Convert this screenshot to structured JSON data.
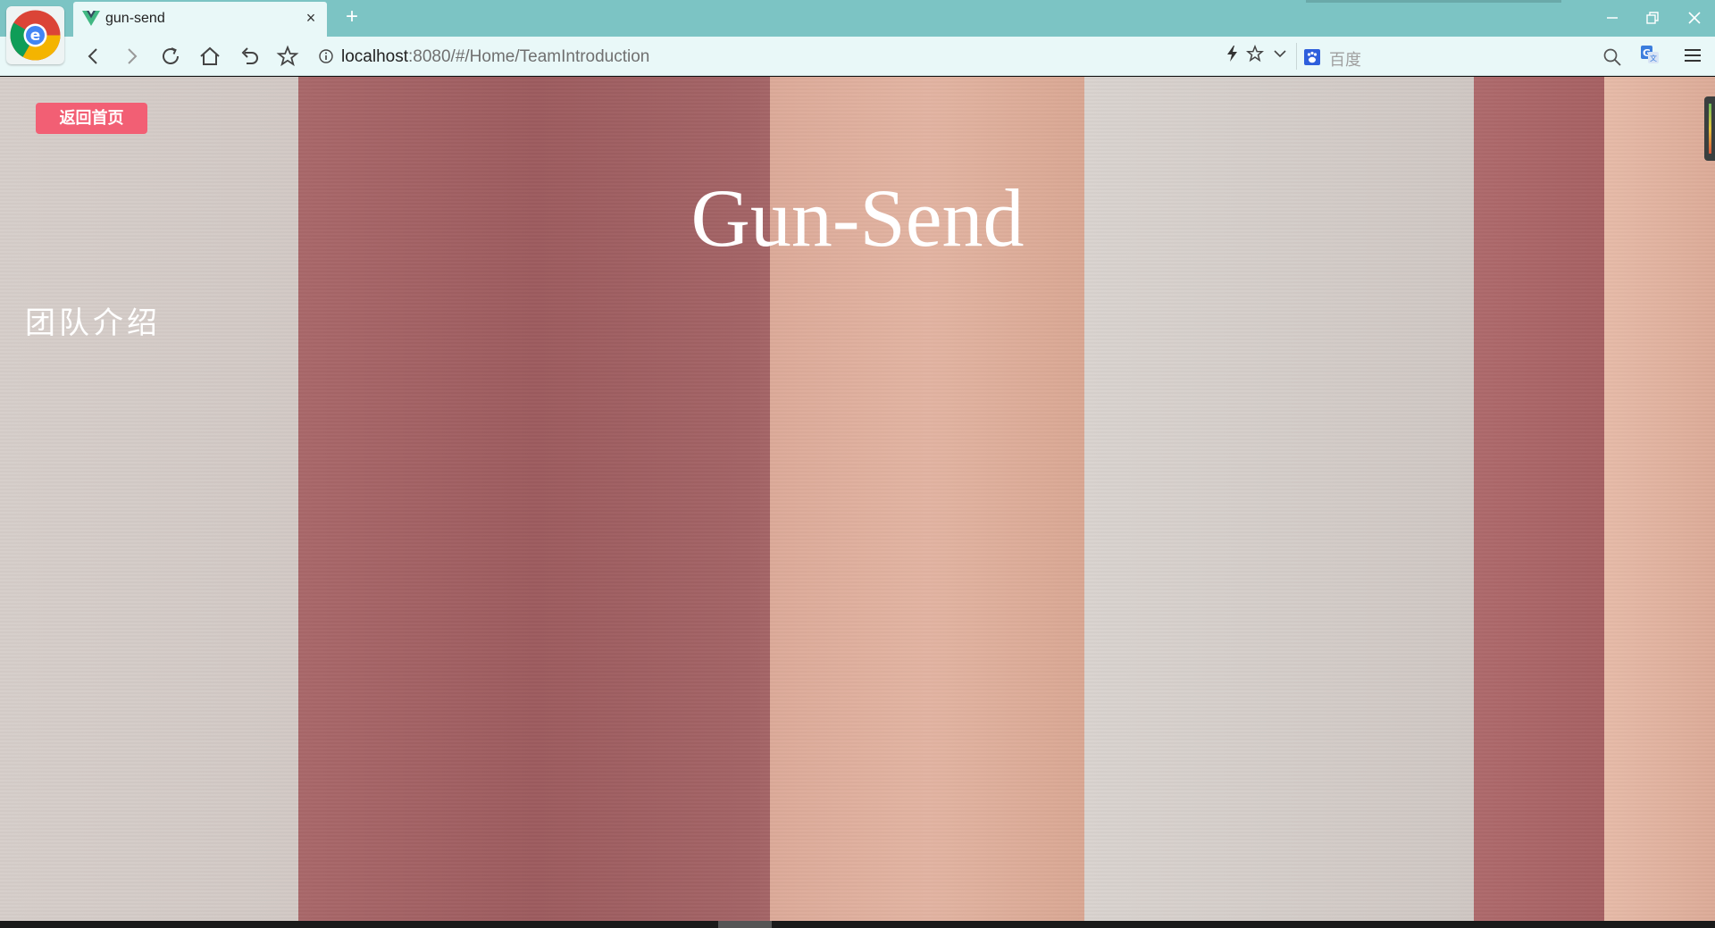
{
  "browser": {
    "tab_title": "gun-send",
    "new_tab_symbol": "+",
    "close_symbol": "×",
    "url_host": "localhost",
    "url_rest": ":8080/#/Home/TeamIntroduction",
    "search_placeholder": "百度"
  },
  "page": {
    "home_button_label": "返回首页",
    "brand_title": "Gun-Send",
    "section_title": "团队介绍"
  },
  "colors": {
    "chrome_teal": "#7cc4c4",
    "toolbar_bg": "#e9f8f8",
    "home_button": "#f25f74",
    "stripe_rose": "#a46567",
    "stripe_peach": "#e0b19f",
    "stripe_gray": "#d5ccc8"
  }
}
